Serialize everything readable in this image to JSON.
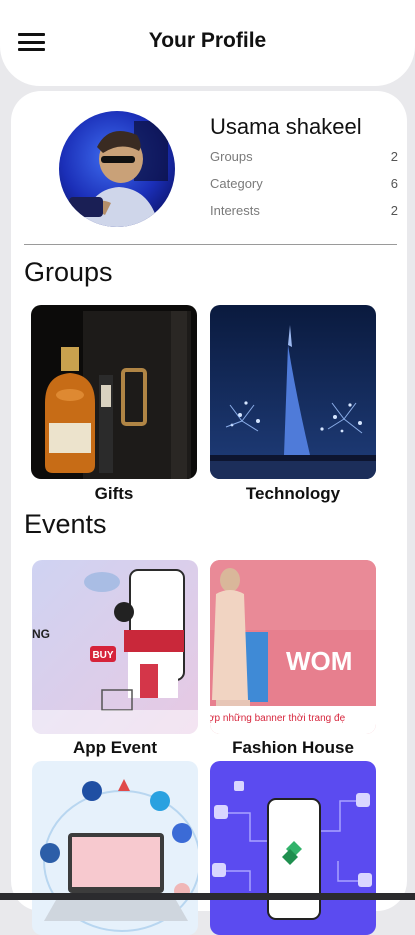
{
  "header": {
    "title": "Your Profile",
    "menu_icon": "hamburger-menu-icon"
  },
  "profile": {
    "name": "Usama shakeel",
    "stats": [
      {
        "label": "Groups",
        "value": "2"
      },
      {
        "label": "Category",
        "value": "6"
      },
      {
        "label": "Interests",
        "value": "2"
      }
    ]
  },
  "groups": {
    "title": "Groups",
    "items": [
      {
        "label": "Gifts"
      },
      {
        "label": "Technology"
      }
    ]
  },
  "events": {
    "title": "Events",
    "items": [
      {
        "label": "App Event",
        "art_text": [
          "BUY",
          "NG"
        ]
      },
      {
        "label": "Fashion House",
        "art_text": [
          "WOM",
          "ợp những banner thời trang đẹ"
        ]
      }
    ]
  },
  "colors": {
    "background": "#e9e9ec",
    "surface": "#ffffff",
    "text": "#111111",
    "muted": "#7a7a7a"
  }
}
